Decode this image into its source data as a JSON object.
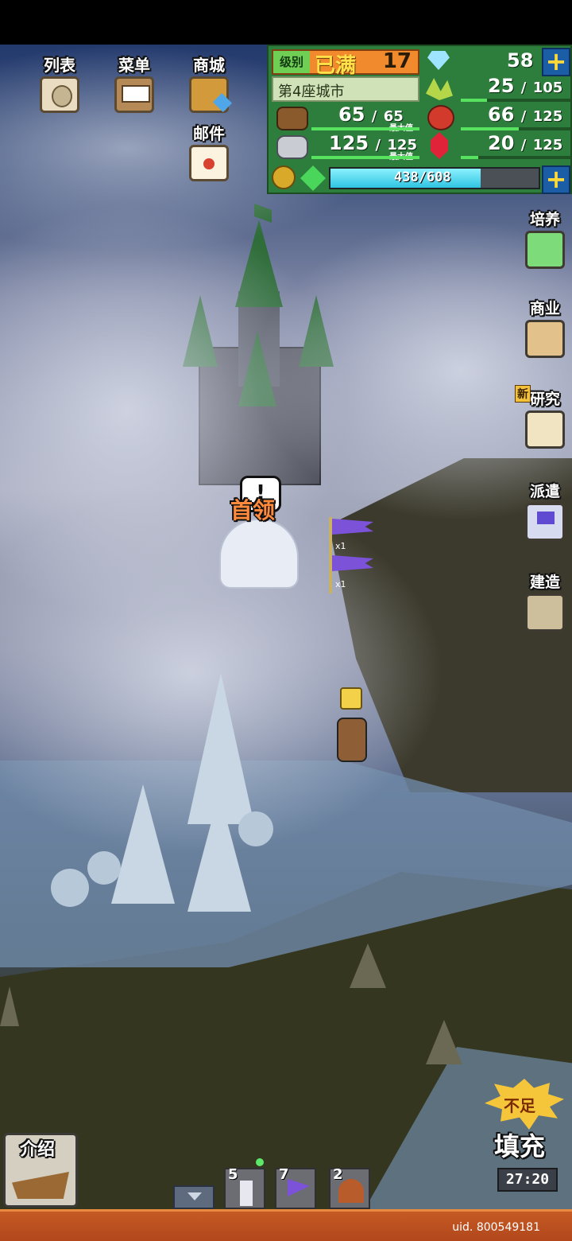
{
  "top_menu": [
    {
      "label": "列表",
      "icon": "list-bag-icon"
    },
    {
      "label": "菜单",
      "icon": "menu-signboard-icon"
    },
    {
      "label": "商城",
      "icon": "shop-chest-icon"
    },
    {
      "label": "邮件",
      "icon": "mail-letter-icon"
    }
  ],
  "status": {
    "level_label": "级别",
    "level_state": "已满",
    "level_value": "17",
    "diamonds": "58",
    "city_name": "第4座城市",
    "wood": {
      "value": "65",
      "max": "65",
      "max_label": "最大值"
    },
    "stone": {
      "value": "125",
      "max": "125",
      "max_label": "最大值"
    },
    "grain": {
      "value": "25",
      "max": "105",
      "fill": 0.24
    },
    "food": {
      "value": "66",
      "max": "125",
      "fill": 0.53
    },
    "ruby": {
      "value": "20",
      "max": "125",
      "fill": 0.16
    },
    "exp": {
      "value": "438",
      "max": "608",
      "fill": 0.72
    },
    "separator": "/"
  },
  "side_menu": [
    {
      "label": "培养",
      "icon": "train-arrow-icon"
    },
    {
      "label": "商业",
      "icon": "shop-house-icon"
    },
    {
      "label": "研究",
      "icon": "research-book-icon",
      "badge": "新"
    },
    {
      "label": "派遣",
      "icon": "dispatch-flag-icon"
    },
    {
      "label": "建造",
      "icon": "build-hammer-icon"
    }
  ],
  "map": {
    "boss_label": "首领",
    "flag_count_1": "x1",
    "flag_count_2": "x1"
  },
  "bottom": {
    "intro_label": "介绍",
    "units": [
      {
        "count": "5",
        "icon": "tower-unit-icon"
      },
      {
        "count": "7",
        "icon": "purple-flag-unit-icon"
      },
      {
        "count": "2",
        "icon": "cave-unit-icon"
      }
    ],
    "refill_badge": "不足",
    "refill_label": "填充",
    "refill_timer": "27:20",
    "uid": "uid. 800549181"
  },
  "colors": {
    "panel_green": "#2d7d3c",
    "level_orange": "#f08a2c",
    "bottom_bar": "#c65a24",
    "flag_purple": "#7b52d8"
  }
}
